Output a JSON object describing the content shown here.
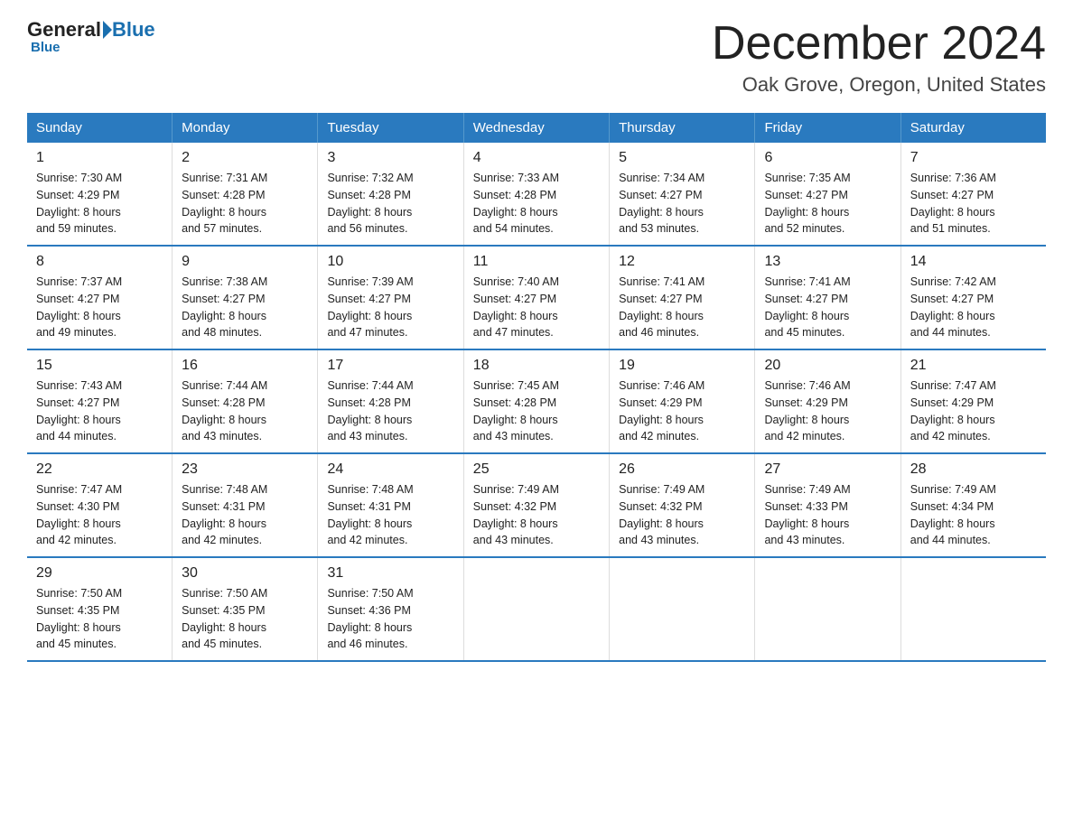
{
  "header": {
    "logo": {
      "general": "General",
      "triangle": "",
      "blue": "Blue"
    },
    "title": "December 2024",
    "subtitle": "Oak Grove, Oregon, United States"
  },
  "days_of_week": [
    "Sunday",
    "Monday",
    "Tuesday",
    "Wednesday",
    "Thursday",
    "Friday",
    "Saturday"
  ],
  "weeks": [
    [
      {
        "day": "1",
        "sunrise": "7:30 AM",
        "sunset": "4:29 PM",
        "daylight": "8 hours and 59 minutes."
      },
      {
        "day": "2",
        "sunrise": "7:31 AM",
        "sunset": "4:28 PM",
        "daylight": "8 hours and 57 minutes."
      },
      {
        "day": "3",
        "sunrise": "7:32 AM",
        "sunset": "4:28 PM",
        "daylight": "8 hours and 56 minutes."
      },
      {
        "day": "4",
        "sunrise": "7:33 AM",
        "sunset": "4:28 PM",
        "daylight": "8 hours and 54 minutes."
      },
      {
        "day": "5",
        "sunrise": "7:34 AM",
        "sunset": "4:27 PM",
        "daylight": "8 hours and 53 minutes."
      },
      {
        "day": "6",
        "sunrise": "7:35 AM",
        "sunset": "4:27 PM",
        "daylight": "8 hours and 52 minutes."
      },
      {
        "day": "7",
        "sunrise": "7:36 AM",
        "sunset": "4:27 PM",
        "daylight": "8 hours and 51 minutes."
      }
    ],
    [
      {
        "day": "8",
        "sunrise": "7:37 AM",
        "sunset": "4:27 PM",
        "daylight": "8 hours and 49 minutes."
      },
      {
        "day": "9",
        "sunrise": "7:38 AM",
        "sunset": "4:27 PM",
        "daylight": "8 hours and 48 minutes."
      },
      {
        "day": "10",
        "sunrise": "7:39 AM",
        "sunset": "4:27 PM",
        "daylight": "8 hours and 47 minutes."
      },
      {
        "day": "11",
        "sunrise": "7:40 AM",
        "sunset": "4:27 PM",
        "daylight": "8 hours and 47 minutes."
      },
      {
        "day": "12",
        "sunrise": "7:41 AM",
        "sunset": "4:27 PM",
        "daylight": "8 hours and 46 minutes."
      },
      {
        "day": "13",
        "sunrise": "7:41 AM",
        "sunset": "4:27 PM",
        "daylight": "8 hours and 45 minutes."
      },
      {
        "day": "14",
        "sunrise": "7:42 AM",
        "sunset": "4:27 PM",
        "daylight": "8 hours and 44 minutes."
      }
    ],
    [
      {
        "day": "15",
        "sunrise": "7:43 AM",
        "sunset": "4:27 PM",
        "daylight": "8 hours and 44 minutes."
      },
      {
        "day": "16",
        "sunrise": "7:44 AM",
        "sunset": "4:28 PM",
        "daylight": "8 hours and 43 minutes."
      },
      {
        "day": "17",
        "sunrise": "7:44 AM",
        "sunset": "4:28 PM",
        "daylight": "8 hours and 43 minutes."
      },
      {
        "day": "18",
        "sunrise": "7:45 AM",
        "sunset": "4:28 PM",
        "daylight": "8 hours and 43 minutes."
      },
      {
        "day": "19",
        "sunrise": "7:46 AM",
        "sunset": "4:29 PM",
        "daylight": "8 hours and 42 minutes."
      },
      {
        "day": "20",
        "sunrise": "7:46 AM",
        "sunset": "4:29 PM",
        "daylight": "8 hours and 42 minutes."
      },
      {
        "day": "21",
        "sunrise": "7:47 AM",
        "sunset": "4:29 PM",
        "daylight": "8 hours and 42 minutes."
      }
    ],
    [
      {
        "day": "22",
        "sunrise": "7:47 AM",
        "sunset": "4:30 PM",
        "daylight": "8 hours and 42 minutes."
      },
      {
        "day": "23",
        "sunrise": "7:48 AM",
        "sunset": "4:31 PM",
        "daylight": "8 hours and 42 minutes."
      },
      {
        "day": "24",
        "sunrise": "7:48 AM",
        "sunset": "4:31 PM",
        "daylight": "8 hours and 42 minutes."
      },
      {
        "day": "25",
        "sunrise": "7:49 AM",
        "sunset": "4:32 PM",
        "daylight": "8 hours and 43 minutes."
      },
      {
        "day": "26",
        "sunrise": "7:49 AM",
        "sunset": "4:32 PM",
        "daylight": "8 hours and 43 minutes."
      },
      {
        "day": "27",
        "sunrise": "7:49 AM",
        "sunset": "4:33 PM",
        "daylight": "8 hours and 43 minutes."
      },
      {
        "day": "28",
        "sunrise": "7:49 AM",
        "sunset": "4:34 PM",
        "daylight": "8 hours and 44 minutes."
      }
    ],
    [
      {
        "day": "29",
        "sunrise": "7:50 AM",
        "sunset": "4:35 PM",
        "daylight": "8 hours and 45 minutes."
      },
      {
        "day": "30",
        "sunrise": "7:50 AM",
        "sunset": "4:35 PM",
        "daylight": "8 hours and 45 minutes."
      },
      {
        "day": "31",
        "sunrise": "7:50 AM",
        "sunset": "4:36 PM",
        "daylight": "8 hours and 46 minutes."
      },
      null,
      null,
      null,
      null
    ]
  ],
  "labels": {
    "sunrise": "Sunrise:",
    "sunset": "Sunset:",
    "daylight": "Daylight:"
  }
}
